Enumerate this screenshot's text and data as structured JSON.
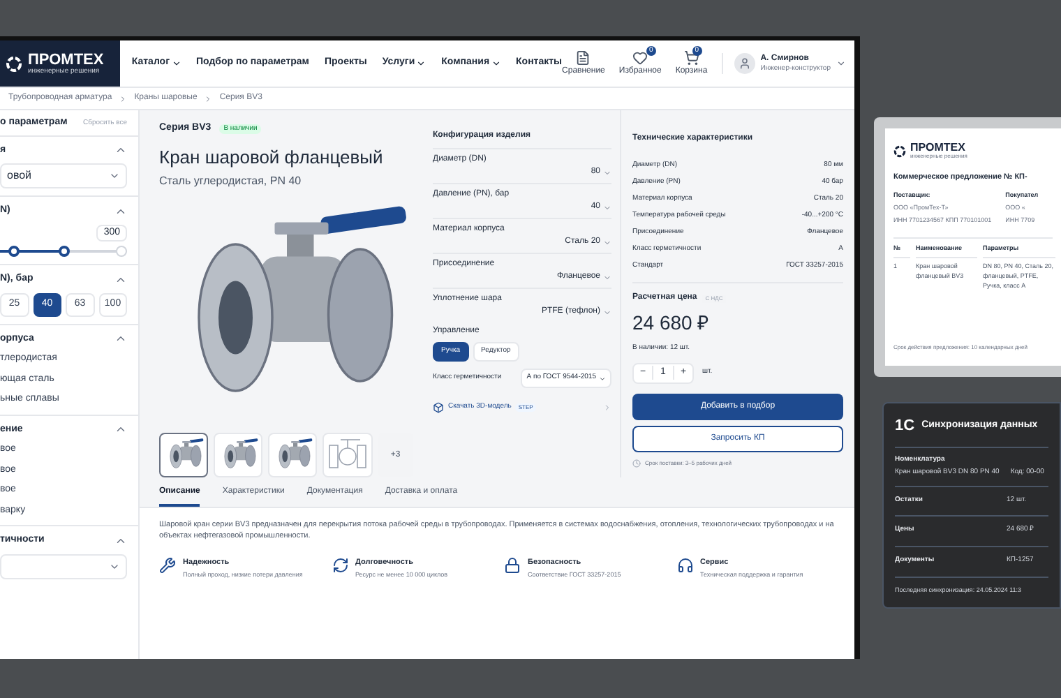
{
  "nav": {
    "logo": {
      "name": "ПРОМТЕХ",
      "tagline": "инженерные решения"
    },
    "items": [
      {
        "label": "Каталог",
        "dropdown": true
      },
      {
        "label": "Подбор по параметрам",
        "dropdown": false
      },
      {
        "label": "Проекты",
        "dropdown": false
      },
      {
        "label": "Услуги",
        "dropdown": true
      },
      {
        "label": "Компания",
        "dropdown": true
      },
      {
        "label": "Контакты",
        "dropdown": false
      }
    ],
    "actions": [
      {
        "kind": "compare",
        "label": "Сравнение"
      },
      {
        "kind": "favorites",
        "label": "Избранное",
        "badge": "0"
      },
      {
        "kind": "cart",
        "label": "Корзина",
        "badge": "0"
      }
    ],
    "user": {
      "name": "А. Смирнов",
      "role": "Инженер-конструктор"
    }
  },
  "breadcrumbs": [
    "Трубопроводная арматура",
    "Краны шаровые",
    "Серия BV3"
  ],
  "filters": {
    "title": "о параметрам",
    "reset": "Сбросить все",
    "sections": [
      {
        "kind": "select",
        "title": "я",
        "expanded": true,
        "value": "овой"
      },
      {
        "kind": "range",
        "title": "N)",
        "expanded": true,
        "max": "300",
        "level": 0.5
      },
      {
        "kind": "chips",
        "title": "N), бар",
        "expanded": true,
        "options": [
          {
            "label": "25",
            "selected": false
          },
          {
            "label": "40",
            "selected": true
          },
          {
            "label": "63",
            "selected": false
          },
          {
            "label": "100",
            "selected": false
          }
        ]
      },
      {
        "kind": "list",
        "title": "орпуса",
        "expanded": true,
        "options": [
          "тлеродистая",
          "ющая сталь",
          "ьные сплавы"
        ]
      },
      {
        "kind": "list",
        "title": "ение",
        "expanded": true,
        "options": [
          "вое",
          "вое",
          "вое",
          "варку"
        ]
      },
      {
        "kind": "select",
        "title": "тичности",
        "expanded": true
      }
    ]
  },
  "product": {
    "series": "Серия BV3",
    "stock_badge": "В наличии",
    "title": "Кран шаровой фланцевый",
    "subtitle": "Сталь углеродистая, PN 40",
    "thumbnails": [
      {
        "kind": "photo",
        "selected": true
      },
      {
        "kind": "photo",
        "selected": false
      },
      {
        "kind": "photo",
        "selected": false
      },
      {
        "kind": "scheme",
        "selected": false
      }
    ],
    "more": "+3"
  },
  "config": {
    "title": "Конфигурация изделия",
    "rows": [
      {
        "label": "Диаметр (DN)",
        "value": "80"
      },
      {
        "label": "Давление (PN), бар",
        "value": "40"
      },
      {
        "label": "Материал корпуса",
        "value": "Сталь 20"
      },
      {
        "label": "Присоединение",
        "value": "Фланцевое"
      },
      {
        "label": "Уплотнение шара",
        "value": "PTFE (тефлон)"
      }
    ],
    "control_label": "Управление",
    "controls": [
      {
        "label": "Ручка",
        "selected": true
      },
      {
        "label": "Редуктор",
        "selected": false
      }
    ],
    "tightness_label": "Класс герметичности",
    "tightness_value": "А по ГОСТ 9544-2015",
    "download": "Скачать 3D-модель",
    "download_badge": "STEP"
  },
  "specs": {
    "title": "Технические характеристики",
    "rows": [
      {
        "label": "Диаметр (DN)",
        "value": "80 мм"
      },
      {
        "label": "Давление (PN)",
        "value": "40 бар"
      },
      {
        "label": "Материал корпуса",
        "value": "Сталь 20"
      },
      {
        "label": "Температура рабочей среды",
        "value": "-40...+200 °C"
      },
      {
        "label": "Присоединение",
        "value": "Фланцевое"
      },
      {
        "label": "Класс герметичности",
        "value": "A"
      },
      {
        "label": "Стандарт",
        "value": "ГОСТ 33257-2015"
      }
    ]
  },
  "price": {
    "label": "Расчетная цена",
    "vat": "С НДС",
    "value": "24 680 ₽",
    "stock": "В наличии: 12 шт.",
    "minus": "−",
    "qty": "1",
    "plus": "+",
    "unit": "шт.",
    "primary": "Добавить в подбор",
    "secondary": "Запросить КП",
    "delivery": "Срок поставки: 3–5 рабочих дней"
  },
  "tabs": [
    {
      "label": "Описание",
      "selected": true
    },
    {
      "label": "Характеристики",
      "selected": false
    },
    {
      "label": "Документация",
      "selected": false
    },
    {
      "label": "Доставка и оплата",
      "selected": false
    }
  ],
  "description": "Шаровой кран серии BV3 предназначен для перекрытия потока рабочей среды в трубопроводах. Применяется в системах водоснабжения, отопления, технологических трубопроводах и на объектах нефтегазовой промышленности.",
  "features": [
    {
      "kind": "reliability",
      "title": "Надежность",
      "text": "Полный проход, низкие потери давления"
    },
    {
      "kind": "durability",
      "title": "Долговечность",
      "text": "Ресурс не менее 10 000 циклов"
    },
    {
      "kind": "safety",
      "title": "Безопасность",
      "text": "Соответствие ГОСТ 33257-2015"
    },
    {
      "kind": "service",
      "title": "Сервис",
      "text": "Техническая поддержка и гарантия"
    }
  ],
  "offer": {
    "logo": "ПРОМТЕХ",
    "tagline": "инженерные решения",
    "title": "Коммерческое предложение № КП-",
    "supplier_label": "Поставщик:",
    "supplier_lines": [
      "ООО «ПромТех-Т»",
      "ИНН 7701234567  КПП 770101001"
    ],
    "buyer_label": "Покупател",
    "buyer_lines": [
      "ООО «",
      "ИНН 7709"
    ],
    "columns": [
      "№",
      "Наименование",
      "Параметры"
    ],
    "rows": [
      [
        "1",
        "Кран шаровой фланцевый BV3",
        "DN 80, PN 40, Сталь 20, фланцевый, PTFE, Ручка, класс А"
      ]
    ],
    "validity": "Срок действия предложения: 10 календарных дней"
  },
  "sync": {
    "logo": "1С",
    "title": "Синхронизация данных",
    "nomenclature_label": "Номенклатура",
    "nomenclature_value": "Кран шаровой BV3 DN 80 PN 40",
    "code": "Код: 00-00",
    "rows": [
      {
        "label": "Остатки",
        "value": "12 шт."
      },
      {
        "label": "Цены",
        "value": "24 680 ₽"
      },
      {
        "label": "Документы",
        "value": "КП-1257"
      }
    ],
    "last": "Последняя синхронизация: 24.05.2024 11:3"
  }
}
